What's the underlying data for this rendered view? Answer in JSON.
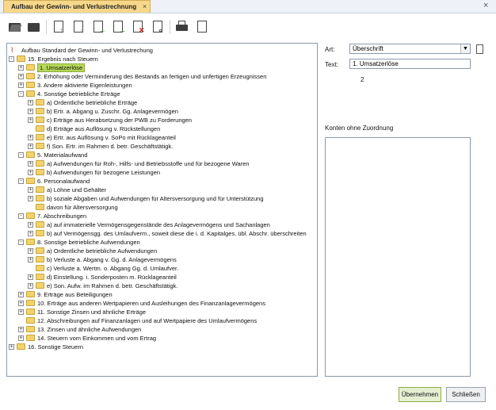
{
  "window": {
    "tab_title": "Aufbau der Gewinn- und Verlustrechnung",
    "tab_close": "×",
    "close": "×"
  },
  "toolbar": {
    "buttons": [
      {
        "name": "new-folder"
      },
      {
        "name": "open-folder"
      },
      {
        "name": "move-up"
      },
      {
        "name": "move-down"
      },
      {
        "name": "indent"
      },
      {
        "name": "outdent"
      },
      {
        "name": "delete"
      },
      {
        "name": "search"
      },
      {
        "name": "print"
      },
      {
        "name": "new-document"
      }
    ]
  },
  "tree": {
    "root": "Aufbau Standard der Gewinn- und Verlustrechung",
    "rows": [
      {
        "level": 1,
        "exp": "-",
        "label": "15. Ergebnis nach Steuern",
        "icon": "root-folder"
      },
      {
        "level": 2,
        "exp": "+",
        "label": "1. Umsatzerlöse",
        "selected": true
      },
      {
        "level": 2,
        "exp": "+",
        "label": "2. Erhöhung oder Verminderung des Bestands an fertigen und unfertigen Erzeugnissen"
      },
      {
        "level": 2,
        "exp": "+",
        "label": "3. Andere aktivierte Eigenleistungen"
      },
      {
        "level": 2,
        "exp": "-",
        "label": "4. Sonstige betriebliche Erträge"
      },
      {
        "level": 3,
        "exp": "+",
        "label": "a) Ordentliche betriebliche Erträge"
      },
      {
        "level": 3,
        "exp": "+",
        "label": "b) Ertr. a. Abgang u. Zuschr. Gg. Anlagevermögen"
      },
      {
        "level": 3,
        "exp": "+",
        "label": "c) Erträge aus Herabsetzung der PWB zu Forderungen"
      },
      {
        "level": 3,
        "exp": "",
        "label": "d) Erträge aus Auflösung v. Rückstellungen"
      },
      {
        "level": 3,
        "exp": "+",
        "label": "e) Ertr. aus Auflösung v. SoPo mit Rücklageanteil"
      },
      {
        "level": 3,
        "exp": "+",
        "label": "f) Son. Ertr. im Rahmen d. betr. Geschäftstätigk."
      },
      {
        "level": 2,
        "exp": "-",
        "label": "5. Materialaufwand"
      },
      {
        "level": 3,
        "exp": "+",
        "label": "a) Aufwendungen für Roh-, Hilfs- und Betriebsstoffe und für bezogene Waren"
      },
      {
        "level": 3,
        "exp": "+",
        "label": "b) Aufwendungen für bezogene Leistungen"
      },
      {
        "level": 2,
        "exp": "-",
        "label": "6. Personalaufwand"
      },
      {
        "level": 3,
        "exp": "+",
        "label": "a) Löhne und Gehälter"
      },
      {
        "level": 3,
        "exp": "+",
        "label": "b) soziale Abgaben und Aufwendungen für Altersversorgung und für Unterstützung"
      },
      {
        "level": 3,
        "exp": "",
        "label": "davon für Altersversorgung"
      },
      {
        "level": 2,
        "exp": "-",
        "label": "7. Abschreibungen"
      },
      {
        "level": 3,
        "exp": "+",
        "label": "a) auf immaterielle Vermögensgegenstände des Anlagevermögens und Sachanlagen"
      },
      {
        "level": 3,
        "exp": "+",
        "label": "b) auf Vermögensgg. des Umlaufverm., soweit diese die i. d. Kapitalges. übl. Abschr. überschreiten"
      },
      {
        "level": 2,
        "exp": "-",
        "label": "8. Sonstige betriebliche Aufwendungen"
      },
      {
        "level": 3,
        "exp": "+",
        "label": "a) Ordentliche betriebliche Aufwendungen"
      },
      {
        "level": 3,
        "exp": "+",
        "label": "b) Verluste a. Abgang v. Gg. d. Anlagevermögens"
      },
      {
        "level": 3,
        "exp": "",
        "label": "c) Verluste a. Wertm. o. Abgang Gg. d. Umlaufver."
      },
      {
        "level": 3,
        "exp": "+",
        "label": "d) Einstellung. i. Sonderposten m. Rücklageanteil"
      },
      {
        "level": 3,
        "exp": "+",
        "label": "e) Son. Aufw. im Rahmen d. betr. Geschäftstätigk."
      },
      {
        "level": 2,
        "exp": "+",
        "label": "9. Erträge aus Beteiligungen"
      },
      {
        "level": 2,
        "exp": "+",
        "label": "10. Erträge aus anderen Wertpapieren und Ausleihungen des Finanzanlagevermögens"
      },
      {
        "level": 2,
        "exp": "+",
        "label": "11. Sonstige Zinsen und ähnliche Erträge"
      },
      {
        "level": 2,
        "exp": "",
        "label": "12. Abschreibungen auf Finanzanlagen und auf Wertpapiere des Umlaufvermögens"
      },
      {
        "level": 2,
        "exp": "+",
        "label": "13. Zinsen und ähnliche Aufwendungen"
      },
      {
        "level": 2,
        "exp": "+",
        "label": "14. Steuern vom Einkommen und vom Ertrag"
      },
      {
        "level": 1,
        "exp": "+",
        "label": "16. Sonstige Steuern"
      }
    ]
  },
  "details": {
    "art_label": "Art:",
    "art_value": "Überschrift",
    "text_label": "Text:",
    "text_value": "1. Umsatzerlöse",
    "number": "2",
    "konten_label": "Konten ohne Zuordnung"
  },
  "buttons": {
    "apply": "Übernehmen",
    "close": "Schließen"
  }
}
